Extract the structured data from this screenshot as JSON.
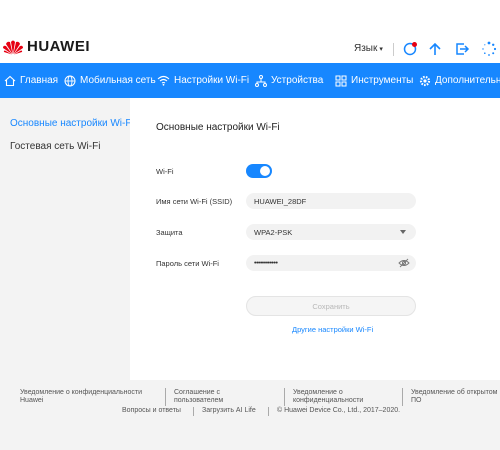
{
  "header": {
    "brand": "HUAWEI",
    "language_label": "Язык",
    "colors": {
      "accent": "#1787ff",
      "logo_red": "#e60012"
    },
    "icons": [
      "update-icon",
      "upload-icon",
      "logout-icon",
      "loading-spinner-icon"
    ]
  },
  "nav": {
    "items": [
      {
        "label": "Главная",
        "icon": "home-icon"
      },
      {
        "label": "Мобильная сеть",
        "icon": "globe-icon"
      },
      {
        "label": "Настройки Wi-Fi",
        "icon": "wifi-icon",
        "active": true
      },
      {
        "label": "Устройства",
        "icon": "devices-icon"
      },
      {
        "label": "Инструменты",
        "icon": "tools-icon"
      },
      {
        "label": "Дополнительно",
        "icon": "gear-icon"
      }
    ]
  },
  "sidebar": {
    "items": [
      {
        "label": "Основные настройки Wi-Fi",
        "active": true
      },
      {
        "label": "Гостевая сеть Wi-Fi"
      }
    ]
  },
  "main": {
    "title": "Основные настройки Wi-Fi",
    "wifi": {
      "label": "Wi-Fi",
      "enabled": true
    },
    "ssid": {
      "label": "Имя сети Wi-Fi (SSID)",
      "value": "HUAWEI_28DF"
    },
    "security": {
      "label": "Защита",
      "value": "WPA2-PSK"
    },
    "password": {
      "label": "Пароль сети Wi-Fi",
      "value": "••••••••••••"
    },
    "save_label": "Сохранить",
    "other_link": "Другие настройки Wi-Fi"
  },
  "footer": {
    "links": [
      "Уведомление о конфиденциальности Huawei",
      "Соглашение с пользователем",
      "Уведомление о конфиденциальности",
      "Уведомление об открытом ПО"
    ],
    "bottom": {
      "faq": "Вопросы и ответы",
      "download": "Загрузить AI Life",
      "copyright": "© Huawei Device Co., Ltd., 2017–2020."
    }
  }
}
